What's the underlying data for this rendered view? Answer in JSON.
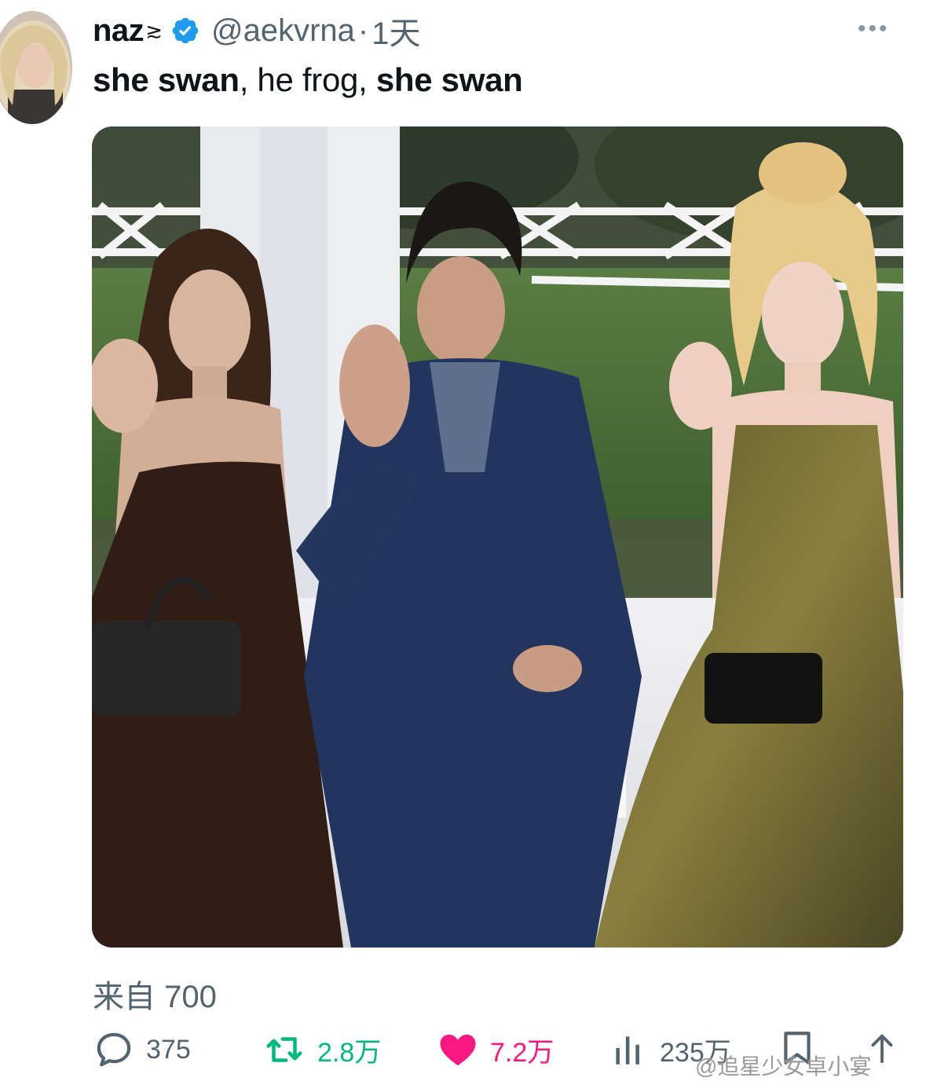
{
  "author": {
    "name": "naz",
    "name_glyph": "≳",
    "verified": true,
    "handle": "@aekvrna",
    "separator": "·",
    "time": "1天"
  },
  "more_label": "•••",
  "tweet": {
    "part1": "she swan",
    "part2": ", he frog, ",
    "part3": "she swan"
  },
  "media": {
    "icon": "volume-muted-icon"
  },
  "source_label": "来自 700",
  "actions": {
    "reply_count": "375",
    "retweet_count": "2.8万",
    "like_count": "7.2万",
    "views_count": "235万"
  },
  "colors": {
    "retweet": "#00ba7c",
    "like": "#f91880",
    "secondary": "#536471",
    "verified": "#1d9bf0"
  },
  "watermark": "@追星少女卓小宴"
}
